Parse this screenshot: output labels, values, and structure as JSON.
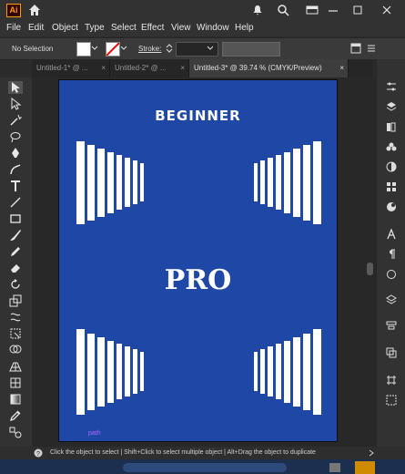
{
  "app": {
    "logo": "Ai",
    "logo_color": "#ff9a00"
  },
  "menu": [
    "File",
    "Edit",
    "Object",
    "Type",
    "Select",
    "Effect",
    "View",
    "Window",
    "Help"
  ],
  "control": {
    "selection_label": "No Selection",
    "stroke_label": "Stroke:"
  },
  "tabs": [
    {
      "label": "Untitled-1* @ ...",
      "close": "×"
    },
    {
      "label": "Untitled-2* @ ...",
      "close": "×"
    },
    {
      "label": "Untitled-3* @ 39.74 % (CMYK/Preview)",
      "close": "×"
    }
  ],
  "artboard": {
    "background": "#1e47a6",
    "title": "BEGINNER",
    "center_text": "PRO",
    "path_label": "path"
  },
  "status": {
    "text": "Click the object to select  |  Shift+Click to select multiple object  |  Alt+Drag the object to duplicate"
  },
  "tools_left": [
    "selection-icon",
    "direct-selection-icon",
    "magic-wand-icon",
    "lasso-icon",
    "pen-icon",
    "curvature-icon",
    "type-icon",
    "line-icon",
    "rectangle-icon",
    "paintbrush-icon",
    "pencil-icon",
    "eraser-icon",
    "rotate-icon",
    "scale-icon",
    "warp-icon",
    "free-transform-icon",
    "shape-builder-icon",
    "perspective-icon",
    "mesh-icon",
    "gradient-icon",
    "eyedropper-icon",
    "blend-icon",
    "symbol-sprayer-icon"
  ],
  "tools_right": [
    "properties-icon",
    "layers-icon",
    "libraries-icon",
    "color-icon",
    "brushes-icon",
    "symbols-icon",
    "swatches-icon",
    "stroke-icon",
    "appearance-icon",
    "type-panel-icon",
    "paragraph-icon",
    "opentype-icon",
    "transform-icon",
    "align-icon",
    "pathfinder-icon",
    "transparency-icon",
    "artboards-icon",
    "asset-export-icon"
  ]
}
